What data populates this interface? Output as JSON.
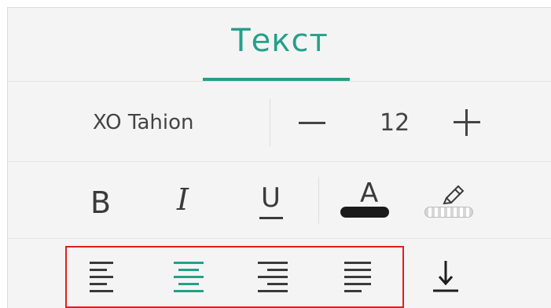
{
  "tab": {
    "title": "Текст"
  },
  "font": {
    "name": "XO Tahion",
    "size": "12"
  },
  "icons": {
    "minus": "minus-icon",
    "plus": "plus-icon",
    "bold": "B",
    "italic": "I",
    "underline": "U",
    "text_color": "A",
    "highlighter": "highlighter-icon",
    "align_left": "align-left-icon",
    "align_center": "align-center-icon",
    "align_right": "align-right-icon",
    "align_justify": "align-justify-icon",
    "valign_bottom": "align-bottom-icon"
  },
  "state": {
    "active_alignment": "center"
  },
  "colors": {
    "accent": "#24a08a",
    "text_color_swatch": "#1a1a1a",
    "highlight_box": "#e0201c"
  }
}
